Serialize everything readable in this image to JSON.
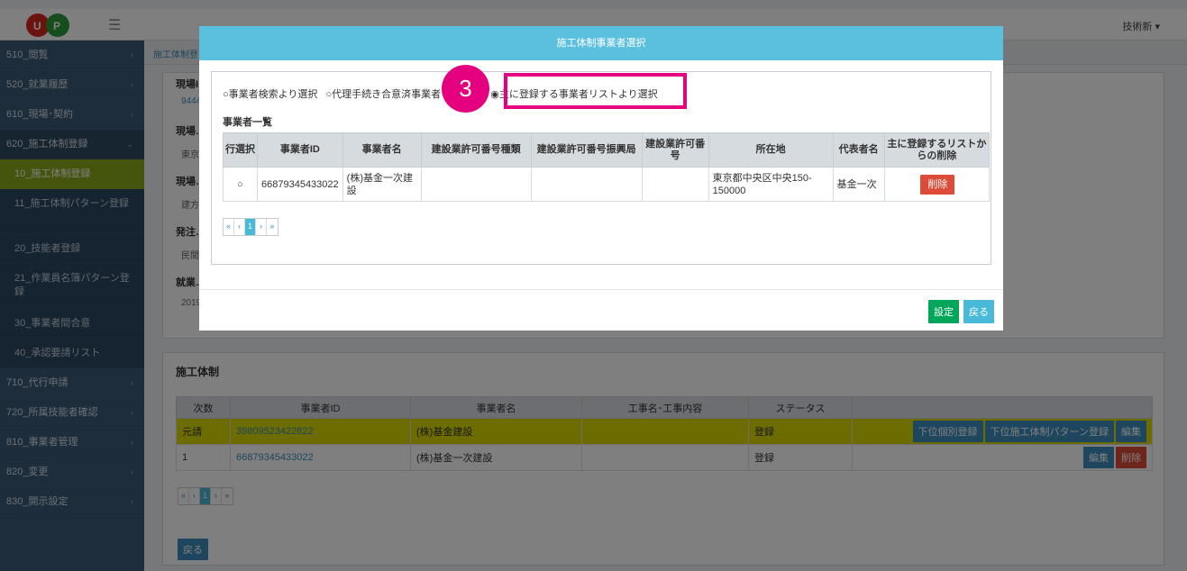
{
  "topbar": {
    "menu_icon": "hamburger-icon",
    "user": "技術新 ▾"
  },
  "sidebar": {
    "items": [
      {
        "label": "510_閲覧"
      },
      {
        "label": "520_就業履歴"
      },
      {
        "label": "610_現場･契約"
      },
      {
        "label": "620_施工体制登録"
      }
    ],
    "sub_items": [
      {
        "label": "10_施工体制登録"
      },
      {
        "label": "11_施工体制パターン登録"
      },
      {
        "label": "20_技能者登録"
      },
      {
        "label": "21_作業員名簿パターン登録"
      },
      {
        "label": "30_事業者間合意"
      },
      {
        "label": "40_承認要請リスト"
      }
    ],
    "items_after": [
      {
        "label": "710_代行申請"
      },
      {
        "label": "720_所属技能者確認"
      },
      {
        "label": "810_事業者管理"
      },
      {
        "label": "820_変更"
      },
      {
        "label": "830_開示設定"
      }
    ]
  },
  "breadcrumb": "施工体制登",
  "background_form": {
    "labels": [
      "現場I",
      "現場…",
      "現場…",
      "発注…",
      "就業…"
    ],
    "values": [
      "9444",
      "東京",
      "建方",
      "民間",
      "2019"
    ]
  },
  "bottom_panel": {
    "title": "施工体制",
    "headers": [
      "次数",
      "事業者ID",
      "事業者名",
      "工事名･工事内容",
      "ステータス",
      ""
    ],
    "rows": [
      {
        "degree": "元請",
        "id": "39809523422822",
        "name": "(株)基金建設",
        "work": "",
        "status": "登録",
        "actions": [
          "下位個別登録",
          "下位施工体制パターン登録",
          "編集"
        ]
      },
      {
        "degree": "1",
        "id": "66879345433022",
        "name": "(株)基金一次建設",
        "work": "",
        "status": "登録",
        "actions": [
          "編集",
          "削除"
        ]
      }
    ],
    "pager": [
      "«",
      "‹",
      "1",
      "›",
      "»"
    ],
    "back_label": "戻る"
  },
  "modal": {
    "title": "施工体制事業者選択",
    "radio_options": [
      {
        "label": "事業者検索より選択",
        "selected": false
      },
      {
        "label": "代理手続き合意済事業者",
        "selected": false
      },
      {
        "label": "選択",
        "selected": false
      },
      {
        "label": "主に登録する事業者リストより選択",
        "selected": true
      }
    ],
    "list_title": "事業者一覧",
    "headers": [
      "行選択",
      "事業者ID",
      "事業者名",
      "建設業許可番号種類",
      "建設業許可番号振興局",
      "建設業許可番号",
      "所在地",
      "代表者名",
      "主に登録するリストからの削除"
    ],
    "rows": [
      {
        "id": "66879345433022",
        "name": "(株)基金一次建設",
        "license_type": "",
        "license_bureau": "",
        "license_no": "",
        "address": "東京都中央区中央150-150000",
        "rep": "基金一次",
        "delete_label": "削除"
      }
    ],
    "pager": [
      "«",
      "‹",
      "1",
      "›",
      "»"
    ],
    "set_label": "設定",
    "back_label": "戻る"
  },
  "annotation": {
    "step": "3",
    "color": "#e4007f"
  },
  "colors": {
    "header": "#5bc0de",
    "sidebar": "#3c5a78",
    "active": "#8aab1c",
    "highlight_row": "#d8d800"
  }
}
